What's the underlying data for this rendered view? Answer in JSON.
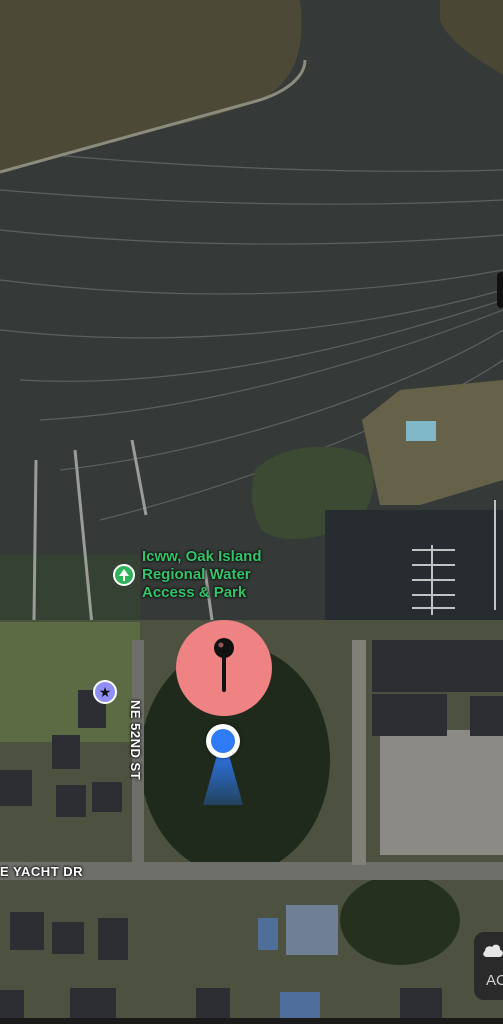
{
  "map": {
    "poi": {
      "lines": [
        "Icww, Oak Island",
        "Regional Water",
        "Access & Park"
      ],
      "icon": "tree-icon",
      "color": "#35c46a"
    },
    "streets": {
      "vertical": "NE 52ND ST",
      "horizontal": "E YACHT DR"
    },
    "favorite_marker": {
      "icon": "star-icon",
      "color": "#8f8ff6"
    },
    "dropped_pin": {
      "icon": "pin-icon",
      "color": "#ef8283"
    },
    "user_location": {
      "icon": "location-dot-icon",
      "color": "#2f7bf5"
    },
    "weather_widget": {
      "icon": "cloud-icon",
      "text": "AC"
    }
  }
}
